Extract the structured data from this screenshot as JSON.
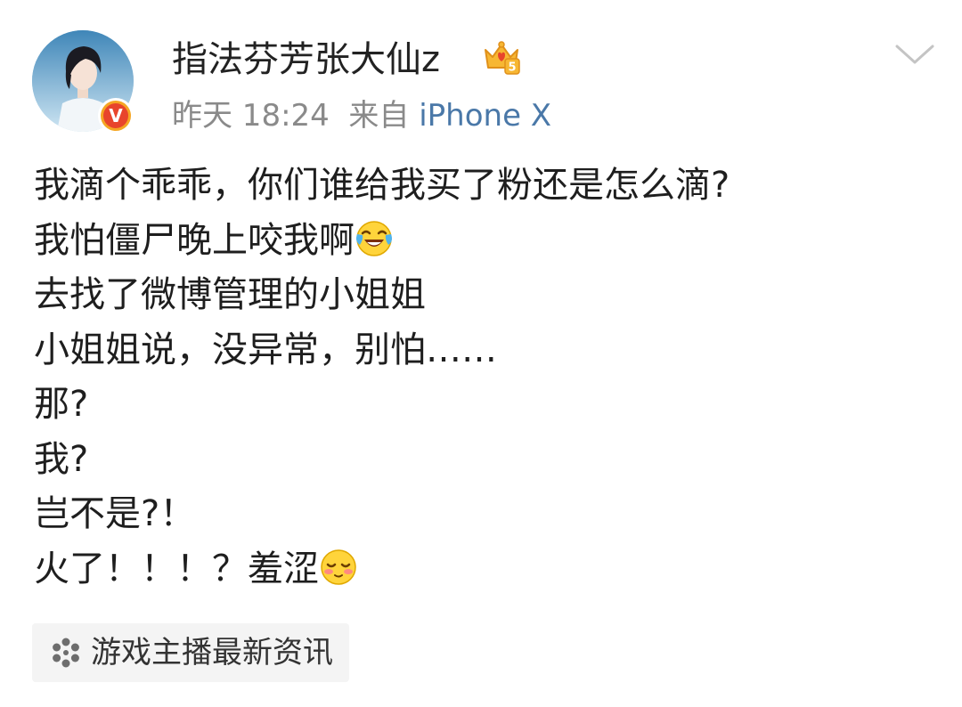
{
  "author": {
    "name": "指法芬芳张大仙z",
    "avatar_icon": "avatar-image",
    "verified_icon": "verified-v-badge",
    "verified_badge_text": "V",
    "vip_icon": "vip-crown-badge",
    "vip_level": "5"
  },
  "meta": {
    "time": "昨天 18:24",
    "source_prefix": "来自",
    "device": "iPhone X"
  },
  "actions": {
    "dropdown_icon": "chevron-down-icon"
  },
  "post": {
    "lines": [
      {
        "text": "我滴个乖乖，你们谁给我买了粉还是怎么滴?"
      },
      {
        "text": "我怕僵尸晚上咬我啊",
        "emoji": "crying-laughing-emoji"
      },
      {
        "text": "去找了微博管理的小姐姐"
      },
      {
        "text": "小姐姐说，没异常，别怕……"
      },
      {
        "text": "那?"
      },
      {
        "text": "我?"
      },
      {
        "text": "岂不是?！"
      },
      {
        "text": "火了！！！？羞涩",
        "emoji": "shy-blush-emoji"
      }
    ]
  },
  "topic": {
    "icon": "topic-pinwheel-icon",
    "label": "游戏主播最新资讯"
  },
  "colors": {
    "link_blue": "#4a78a8",
    "meta_gray": "#8a8a8a",
    "text_dark": "#1e1e1e",
    "tag_bg": "#f4f4f4",
    "verified_orange": "#f5a623",
    "verified_red": "#e8452c"
  }
}
